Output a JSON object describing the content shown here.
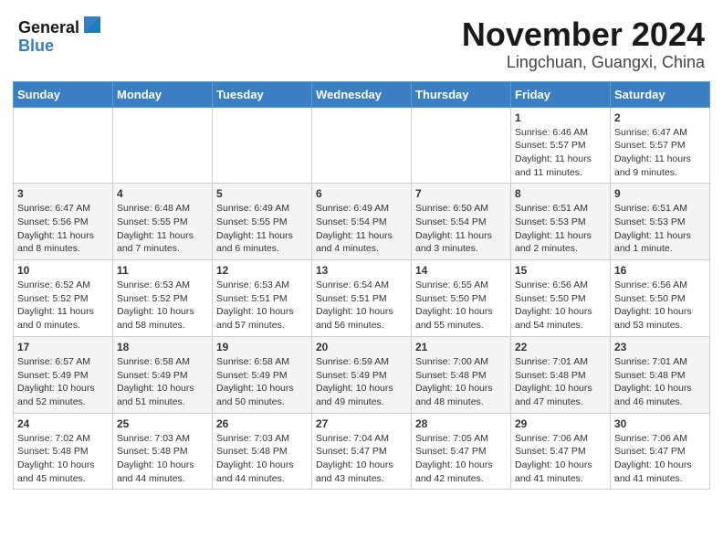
{
  "header": {
    "logo_line1": "General",
    "logo_line2": "Blue",
    "month_title": "November 2024",
    "location": "Lingchuan, Guangxi, China"
  },
  "weekdays": [
    "Sunday",
    "Monday",
    "Tuesday",
    "Wednesday",
    "Thursday",
    "Friday",
    "Saturday"
  ],
  "weeks": [
    [
      {
        "day": "",
        "content": ""
      },
      {
        "day": "",
        "content": ""
      },
      {
        "day": "",
        "content": ""
      },
      {
        "day": "",
        "content": ""
      },
      {
        "day": "",
        "content": ""
      },
      {
        "day": "1",
        "content": "Sunrise: 6:46 AM\nSunset: 5:57 PM\nDaylight: 11 hours\nand 11 minutes."
      },
      {
        "day": "2",
        "content": "Sunrise: 6:47 AM\nSunset: 5:57 PM\nDaylight: 11 hours\nand 9 minutes."
      }
    ],
    [
      {
        "day": "3",
        "content": "Sunrise: 6:47 AM\nSunset: 5:56 PM\nDaylight: 11 hours\nand 8 minutes."
      },
      {
        "day": "4",
        "content": "Sunrise: 6:48 AM\nSunset: 5:55 PM\nDaylight: 11 hours\nand 7 minutes."
      },
      {
        "day": "5",
        "content": "Sunrise: 6:49 AM\nSunset: 5:55 PM\nDaylight: 11 hours\nand 6 minutes."
      },
      {
        "day": "6",
        "content": "Sunrise: 6:49 AM\nSunset: 5:54 PM\nDaylight: 11 hours\nand 4 minutes."
      },
      {
        "day": "7",
        "content": "Sunrise: 6:50 AM\nSunset: 5:54 PM\nDaylight: 11 hours\nand 3 minutes."
      },
      {
        "day": "8",
        "content": "Sunrise: 6:51 AM\nSunset: 5:53 PM\nDaylight: 11 hours\nand 2 minutes."
      },
      {
        "day": "9",
        "content": "Sunrise: 6:51 AM\nSunset: 5:53 PM\nDaylight: 11 hours\nand 1 minute."
      }
    ],
    [
      {
        "day": "10",
        "content": "Sunrise: 6:52 AM\nSunset: 5:52 PM\nDaylight: 11 hours\nand 0 minutes."
      },
      {
        "day": "11",
        "content": "Sunrise: 6:53 AM\nSunset: 5:52 PM\nDaylight: 10 hours\nand 58 minutes."
      },
      {
        "day": "12",
        "content": "Sunrise: 6:53 AM\nSunset: 5:51 PM\nDaylight: 10 hours\nand 57 minutes."
      },
      {
        "day": "13",
        "content": "Sunrise: 6:54 AM\nSunset: 5:51 PM\nDaylight: 10 hours\nand 56 minutes."
      },
      {
        "day": "14",
        "content": "Sunrise: 6:55 AM\nSunset: 5:50 PM\nDaylight: 10 hours\nand 55 minutes."
      },
      {
        "day": "15",
        "content": "Sunrise: 6:56 AM\nSunset: 5:50 PM\nDaylight: 10 hours\nand 54 minutes."
      },
      {
        "day": "16",
        "content": "Sunrise: 6:56 AM\nSunset: 5:50 PM\nDaylight: 10 hours\nand 53 minutes."
      }
    ],
    [
      {
        "day": "17",
        "content": "Sunrise: 6:57 AM\nSunset: 5:49 PM\nDaylight: 10 hours\nand 52 minutes."
      },
      {
        "day": "18",
        "content": "Sunrise: 6:58 AM\nSunset: 5:49 PM\nDaylight: 10 hours\nand 51 minutes."
      },
      {
        "day": "19",
        "content": "Sunrise: 6:58 AM\nSunset: 5:49 PM\nDaylight: 10 hours\nand 50 minutes."
      },
      {
        "day": "20",
        "content": "Sunrise: 6:59 AM\nSunset: 5:49 PM\nDaylight: 10 hours\nand 49 minutes."
      },
      {
        "day": "21",
        "content": "Sunrise: 7:00 AM\nSunset: 5:48 PM\nDaylight: 10 hours\nand 48 minutes."
      },
      {
        "day": "22",
        "content": "Sunrise: 7:01 AM\nSunset: 5:48 PM\nDaylight: 10 hours\nand 47 minutes."
      },
      {
        "day": "23",
        "content": "Sunrise: 7:01 AM\nSunset: 5:48 PM\nDaylight: 10 hours\nand 46 minutes."
      }
    ],
    [
      {
        "day": "24",
        "content": "Sunrise: 7:02 AM\nSunset: 5:48 PM\nDaylight: 10 hours\nand 45 minutes."
      },
      {
        "day": "25",
        "content": "Sunrise: 7:03 AM\nSunset: 5:48 PM\nDaylight: 10 hours\nand 44 minutes."
      },
      {
        "day": "26",
        "content": "Sunrise: 7:03 AM\nSunset: 5:48 PM\nDaylight: 10 hours\nand 44 minutes."
      },
      {
        "day": "27",
        "content": "Sunrise: 7:04 AM\nSunset: 5:47 PM\nDaylight: 10 hours\nand 43 minutes."
      },
      {
        "day": "28",
        "content": "Sunrise: 7:05 AM\nSunset: 5:47 PM\nDaylight: 10 hours\nand 42 minutes."
      },
      {
        "day": "29",
        "content": "Sunrise: 7:06 AM\nSunset: 5:47 PM\nDaylight: 10 hours\nand 41 minutes."
      },
      {
        "day": "30",
        "content": "Sunrise: 7:06 AM\nSunset: 5:47 PM\nDaylight: 10 hours\nand 41 minutes."
      }
    ]
  ]
}
